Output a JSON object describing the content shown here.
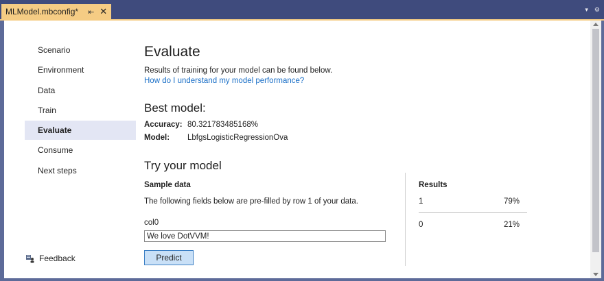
{
  "tab": {
    "title": "MLModel.mbconfig*",
    "pin_glyph": "⇤",
    "close_glyph": "✕"
  },
  "strip": {
    "dropdown_glyph": "▾",
    "settings_glyph": "⚙"
  },
  "nav": {
    "items": [
      {
        "label": "Scenario"
      },
      {
        "label": "Environment"
      },
      {
        "label": "Data"
      },
      {
        "label": "Train"
      },
      {
        "label": "Evaluate"
      },
      {
        "label": "Consume"
      },
      {
        "label": "Next steps"
      }
    ],
    "selected": "Evaluate",
    "feedback_label": "Feedback"
  },
  "main": {
    "title": "Evaluate",
    "intro": "Results of training for your model can be found below.",
    "help_link": "How do I understand my model performance?",
    "best_model": {
      "heading": "Best model:",
      "accuracy_label": "Accuracy:",
      "accuracy_value": "80.321783485168%",
      "model_label": "Model:",
      "model_value": "LbfgsLogisticRegressionOva"
    },
    "try": {
      "heading": "Try your model",
      "sample_heading": "Sample data",
      "sample_note": "The following fields below are pre-filled by row 1 of your data.",
      "field_label": "col0",
      "field_value": "We love DotVVM!",
      "predict_label": "Predict"
    },
    "results": {
      "heading": "Results",
      "rows": [
        {
          "label": "1",
          "percent": "79%"
        },
        {
          "label": "0",
          "percent": "21%"
        }
      ]
    }
  },
  "colors": {
    "tab_active": "#f5cc84",
    "strip": "#3f4b7d",
    "selected_nav": "#e3e6f4",
    "link": "#1a6fc7",
    "button": "#c9e0f7"
  }
}
